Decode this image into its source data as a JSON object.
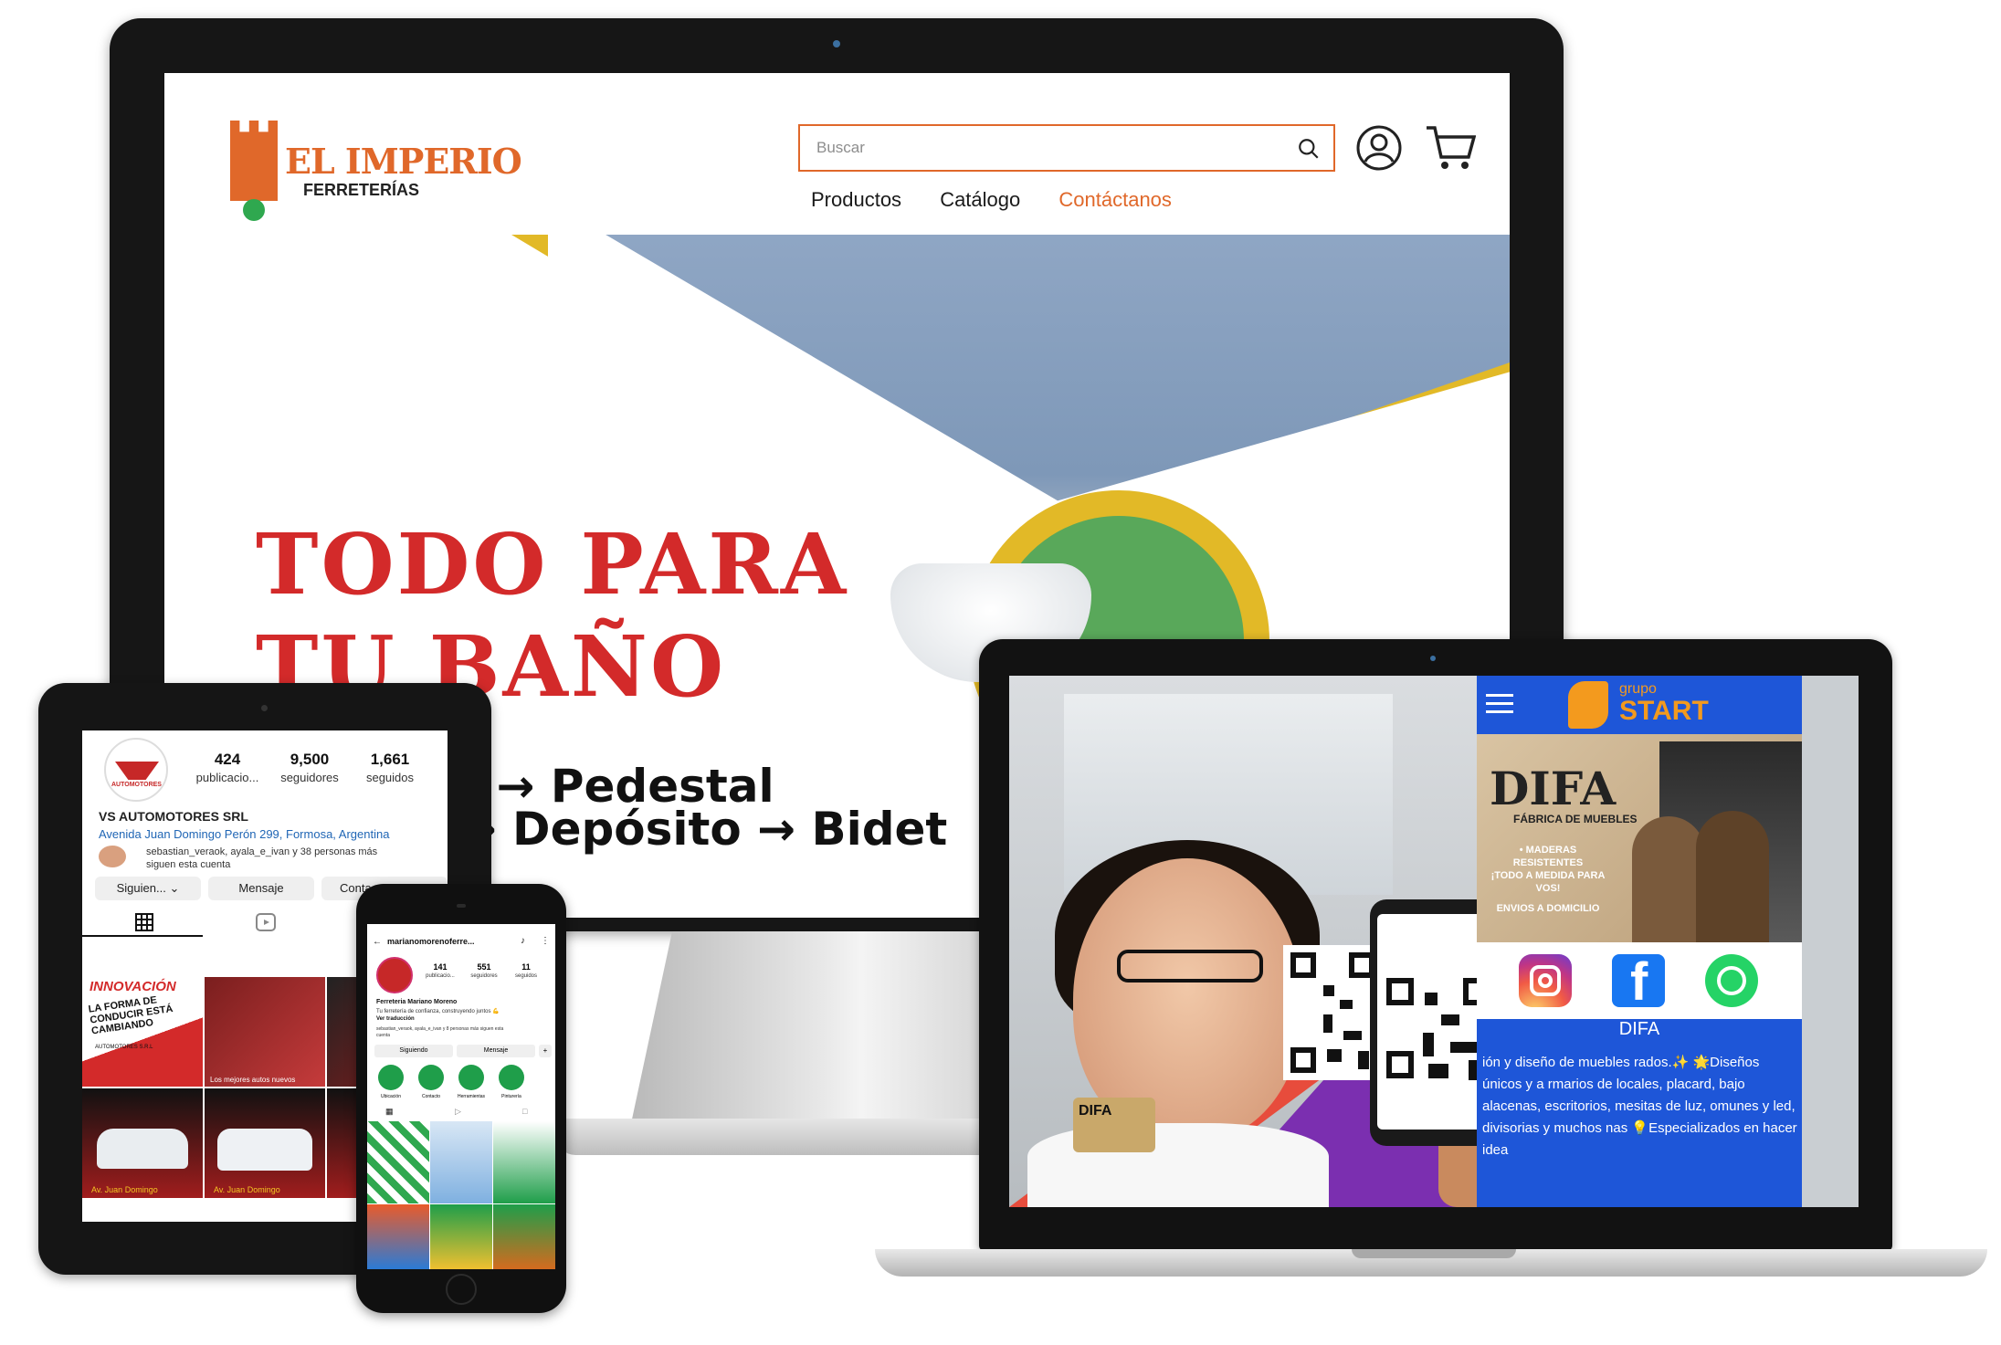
{
  "monitor": {
    "logo": {
      "title": "EL IMPERIO",
      "subtitle": "FERRETERÍAS"
    },
    "search": {
      "placeholder": "Buscar"
    },
    "nav": [
      {
        "label": "Productos"
      },
      {
        "label": "Catálogo"
      },
      {
        "label": "Contáctanos"
      }
    ],
    "hero": {
      "title_line1": "TODO PARA",
      "title_line2": "TU BAÑO",
      "products_line1": "rio → Pedestal",
      "products_line2": "o → Depósito → Bidet"
    },
    "colors": {
      "accent": "#e0682a",
      "hero_red": "#d32a2a",
      "yellow": "#e2b927",
      "green": "#59a85a"
    }
  },
  "tablet": {
    "profile": {
      "stats": [
        {
          "value": "424",
          "label": "publicacio..."
        },
        {
          "value": "9,500",
          "label": "seguidores"
        },
        {
          "value": "1,661",
          "label": "seguidos"
        }
      ],
      "name": "VS AUTOMOTORES SRL",
      "address": "Avenida Juan Domingo Perón 299, Formosa, Argentina",
      "followed_by_line1": "sebastian_veraok, ayala_e_ivan y 38 personas más",
      "followed_by_line2": "siguen esta cuenta",
      "buttons": [
        "Siguien...",
        "Mensaje",
        "Conta"
      ],
      "logo_text": "AUTOMOTORES"
    },
    "posts": [
      {
        "headline": "INNOVACIÓN",
        "text": "LA FORMA DE CONDUCIR ESTÁ CAMBIANDO",
        "brand": "AUTOMOTORES S.R.L"
      },
      {
        "caption": "Los mejores autos nuevos"
      },
      {
        "caption": ""
      },
      {
        "caption": "Av. Juan Domingo"
      },
      {
        "caption": "Av. Juan Domingo"
      },
      {
        "caption": ""
      }
    ]
  },
  "phone": {
    "username": "marianomorenoferre...",
    "stats": [
      {
        "value": "141",
        "label": "publicacio..."
      },
      {
        "value": "551",
        "label": "seguidores"
      },
      {
        "value": "11",
        "label": "seguidos"
      }
    ],
    "name": "Ferreteria Mariano Moreno",
    "bio": "Tu ferretería de confianza, construyendo juntos 💪",
    "translate": "Ver traducción",
    "followers_line": "sebastian_veraok, ayala_e_ivan y 8 personas más siguen esta cuenta",
    "buttons": [
      "Siguiendo",
      "Mensaje"
    ],
    "highlights": [
      "Ubicación",
      "Contacto",
      "Herramientas",
      "Pinturería"
    ]
  },
  "laptop": {
    "brand": {
      "small": "grupo",
      "big": "START"
    },
    "banner": {
      "title": "DIFA",
      "subtitle": "FÁBRICA DE MUEBLES",
      "bullet1": "• MADERAS RESISTENTES",
      "bullet2": "¡TODO A MEDIDA PARA VOS!",
      "bullet3": "ENVIOS A DOMICILIO"
    },
    "card_text": "DIFA",
    "page_title": "DIFA",
    "description": "ión y diseño de muebles rados.✨ 🌟Diseños únicos y a rmarios de locales, placard, bajo alacenas, escritorios, mesitas de luz, omunes y led, divisorias y muchos nas 💡Especializados en hacer idea",
    "social": [
      "instagram-icon",
      "facebook-icon",
      "whatsapp-icon"
    ],
    "colors": {
      "panel_blue": "#1e56d8",
      "brand_orange": "#f39a1e"
    }
  }
}
